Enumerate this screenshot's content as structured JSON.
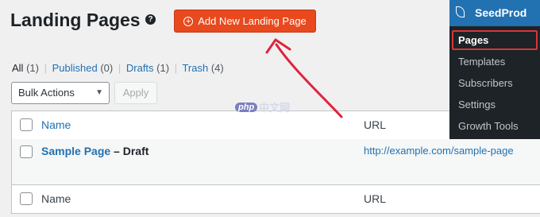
{
  "header": {
    "title": "Landing Pages",
    "help_icon_glyph": "?",
    "add_button_label": "Add New Landing Page",
    "add_button_color": "#e8491d"
  },
  "filters": {
    "all": {
      "label": "All",
      "count": "(1)"
    },
    "published": {
      "label": "Published",
      "count": "(0)"
    },
    "drafts": {
      "label": "Drafts",
      "count": "(1)"
    },
    "trash": {
      "label": "Trash",
      "count": "(4)"
    }
  },
  "bulk_actions": {
    "selected": "Bulk Actions",
    "apply_label": "Apply"
  },
  "table": {
    "columns": {
      "name": "Name",
      "url": "URL"
    },
    "rows": [
      {
        "name": "Sample Page",
        "status": " – Draft",
        "url": "http://example.com/sample-page"
      }
    ]
  },
  "admin_menu": {
    "title": "SeedProd",
    "items": [
      "Pages",
      "Templates",
      "Subscribers",
      "Settings",
      "Growth Tools"
    ],
    "active_item": "Pages",
    "highlight_color": "#d63638"
  },
  "watermark": {
    "logo": "php",
    "text": "中文网"
  },
  "annotation": {
    "arrow_color": "#e0243d"
  }
}
